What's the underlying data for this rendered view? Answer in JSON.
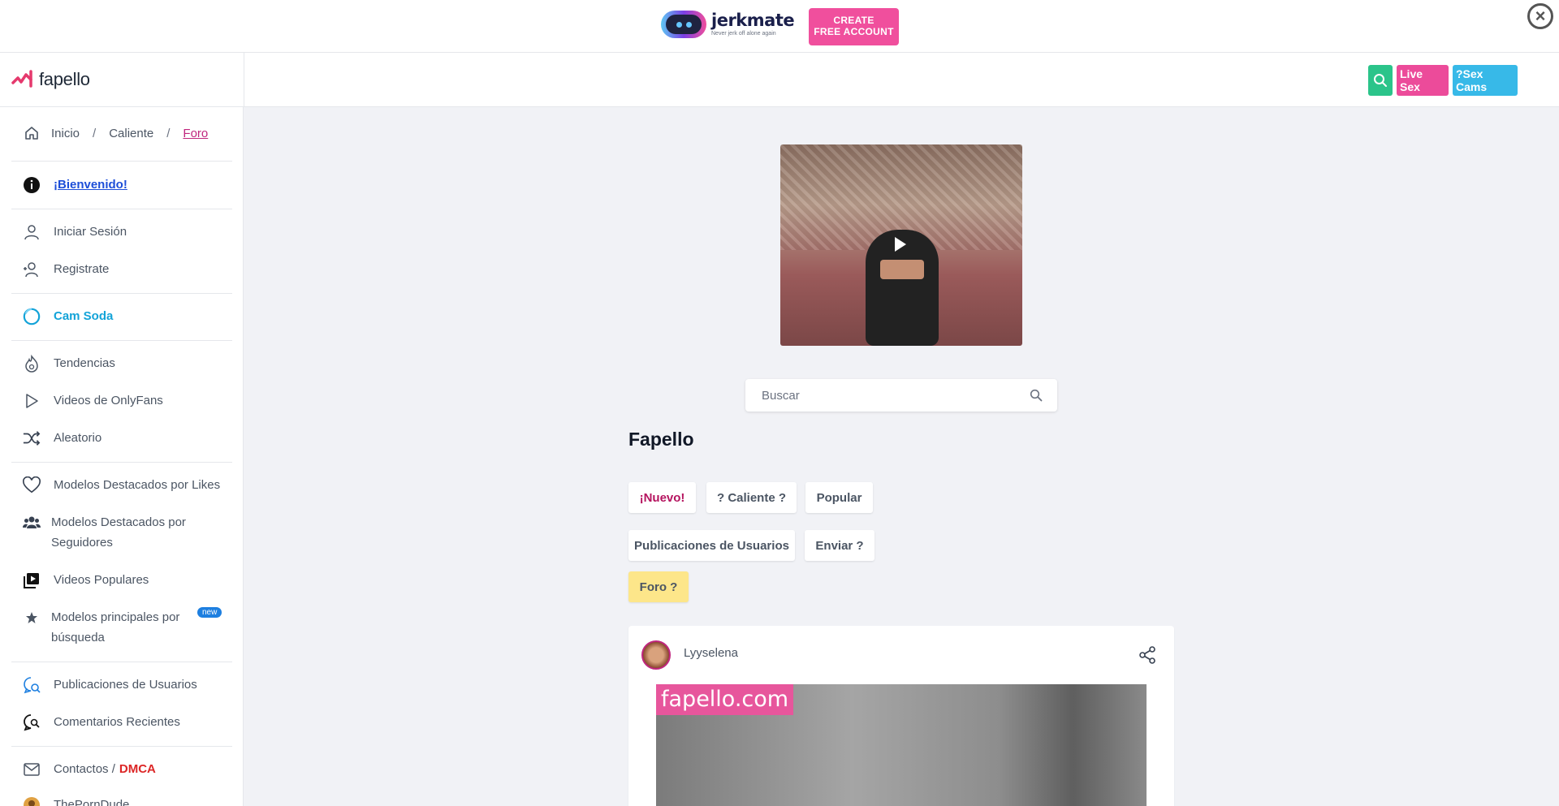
{
  "ad": {
    "brand": "jerkmate",
    "tagline": "Never jerk off alone again",
    "cta_line1": "CREATE",
    "cta_line2": "FREE ACCOUNT"
  },
  "header": {
    "logo_text": "fapello",
    "live_sex_label": "Live Sex",
    "sex_cams_label": "?Sex Cams"
  },
  "breadcrumb": {
    "home": "Inicio",
    "hot": "Caliente",
    "current": "Foro",
    "separator": "/"
  },
  "sidebar": {
    "welcome": "¡Bienvenido!",
    "login": "Iniciar Sesión",
    "register": "Registrate",
    "camsoda": "Cam Soda",
    "trends": "Tendencias",
    "onlyfans": "Videos de OnlyFans",
    "random": "Aleatorio",
    "top_likes": "Modelos Destacados por Likes",
    "top_followers": "Modelos Destacados por Seguidores",
    "popular_videos": "Videos Populares",
    "top_search": "Modelos principales por búsqueda",
    "new_badge": "new",
    "user_posts": "Publicaciones de Usuarios",
    "recent_comments": "Comentarios Recientes",
    "contacts": "Contactos /",
    "dmca": "DMCA",
    "partner": "ThePornDude"
  },
  "search": {
    "placeholder": "Buscar"
  },
  "main": {
    "title": "Fapello",
    "tabs": {
      "nuevo": "¡Nuevo!",
      "caliente": "? Caliente ?",
      "popular": "Popular",
      "publicaciones": "Publicaciones de Usuarios",
      "enviar": "Enviar ?",
      "foro": "Foro ?"
    }
  },
  "post": {
    "username": "Lyyselena",
    "watermark": "fapello.com"
  },
  "colors": {
    "accent_pink": "#c0267e",
    "cam_blue": "#13a3d8",
    "foro_yellow": "#fde68a"
  }
}
